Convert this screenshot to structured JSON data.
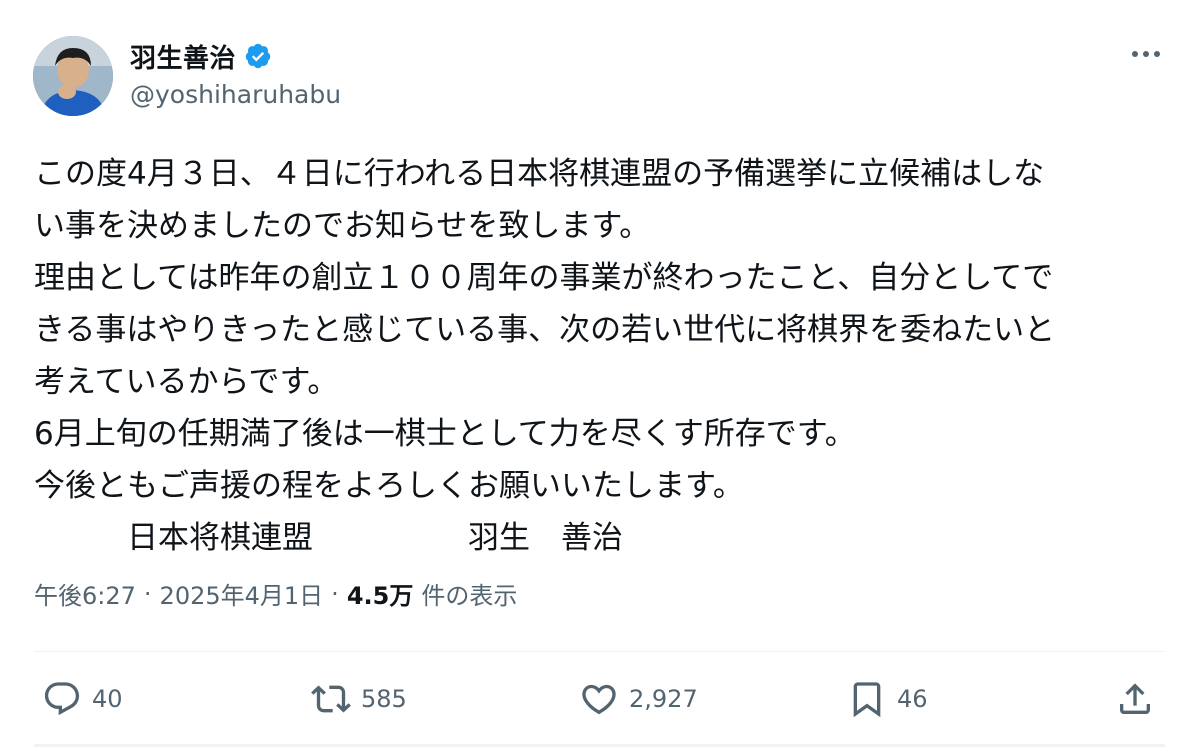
{
  "author": {
    "display_name": "羽生善治",
    "handle": "@yoshiharuhabu",
    "verified": true,
    "verified_color": "#1d9bf0"
  },
  "tweet": {
    "lines": [
      "この度4月３日、４日に行われる日本将棋連盟の予備選挙に立候補はしな",
      "い事を決めましたのでお知らせを致します。",
      "理由としては昨年の創立１００周年の事業が終わったこと、自分としてで",
      "きる事はやりきったと感じている事、次の若い世代に将棋界を委ねたいと",
      "考えているからです。",
      "6月上旬の任期満了後は一棋士として力を尽くす所存です。",
      "今後ともご声援の程をよろしくお願いいたします。",
      "　　　日本将棋連盟　　　　　羽生　善治"
    ]
  },
  "meta": {
    "time": "午後6:27",
    "separator": "·",
    "date": "2025年4月1日",
    "views_count": "4.5万",
    "views_label": "件の表示"
  },
  "actions": {
    "replies": "40",
    "reposts": "585",
    "likes": "2,927",
    "bookmarks": "46"
  },
  "icons": {
    "more": "more-horizontal-icon",
    "reply": "speech-bubble-icon",
    "repost": "repost-arrows-icon",
    "like": "heart-icon",
    "bookmark": "bookmark-icon",
    "share": "share-upload-icon"
  },
  "colors": {
    "text": "#0f1419",
    "secondary": "#536471",
    "divider": "#eff3f4"
  }
}
